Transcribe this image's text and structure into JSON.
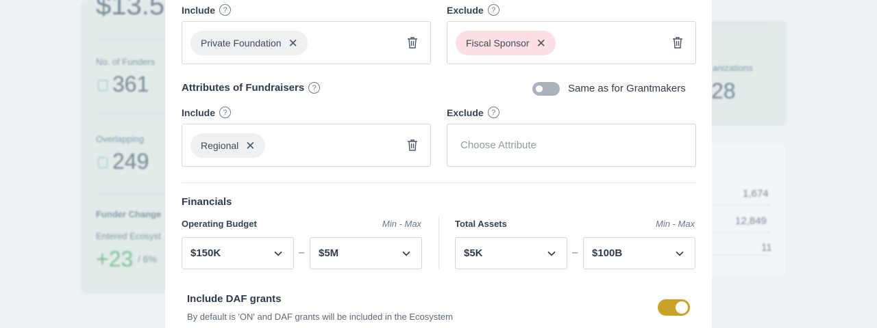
{
  "background": {
    "big_value_top": "$13.5",
    "no_of_funders_label": "No. of Funders",
    "no_of_funders_value": "361",
    "overlapping_label": "Overlapping",
    "overlapping_value": "249",
    "funder_change_label": "Funder Change",
    "entered_ecosystem_label": "Entered Ecosyst",
    "change_value": "+23",
    "change_percent": "/ 6%",
    "organizations_label": "anizations",
    "organizations_value": "28",
    "list_values": [
      "1,674",
      "12,849",
      "11"
    ]
  },
  "modal": {
    "grantmakers": {
      "include_label": "Include",
      "exclude_label": "Exclude",
      "include_chip": "Private Foundation",
      "exclude_chip": "Fiscal Sponsor"
    },
    "fundraisers": {
      "title": "Attributes of Fundraisers",
      "same_as_label": "Same as for Grantmakers",
      "same_as_on": false,
      "include_label": "Include",
      "exclude_label": "Exclude",
      "include_chip": "Regional",
      "exclude_placeholder": "Choose Attribute"
    },
    "financials": {
      "title": "Financials",
      "operating_budget_label": "Operating Budget",
      "operating_minmax": "Min - Max",
      "operating_min": "$150K",
      "operating_max": "$5M",
      "total_assets_label": "Total Assets",
      "assets_minmax": "Min - Max",
      "assets_min": "$5K",
      "assets_max": "$100B",
      "range_dash": "–"
    },
    "daf": {
      "title": "Include DAF grants",
      "description": "By default is 'ON' and DAF grants will be included in the Ecosystem",
      "on": true
    }
  },
  "colors": {
    "toggle_on": "#c9a227",
    "chip_exclude": "#fbe0e4",
    "chip_include": "#eef0f2",
    "positive_change": "#7fc39a"
  }
}
